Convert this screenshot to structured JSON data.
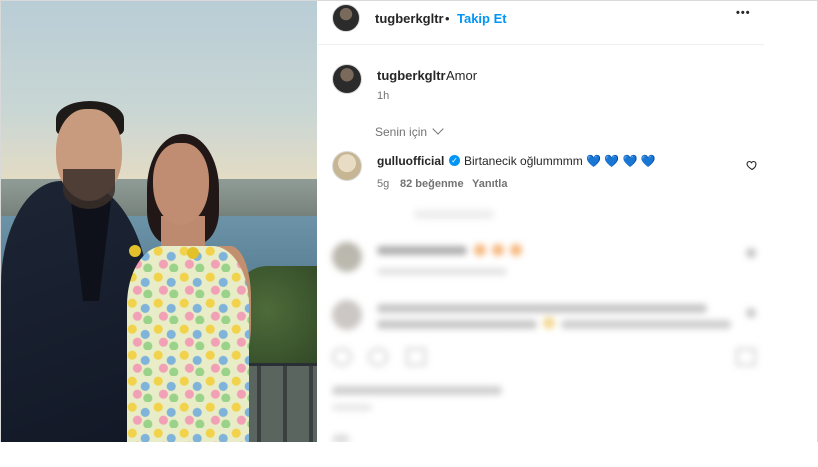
{
  "post": {
    "author": "tugberkgltr",
    "separator": "•",
    "follow_label": "Takip Et",
    "more_label": "•••"
  },
  "caption": {
    "author": "tugberkgltr",
    "text": "Amor",
    "time": "1h"
  },
  "comments_filter": {
    "label": "Senin için"
  },
  "top_comment": {
    "author": "gulluofficial",
    "verified_mark": "✓",
    "text": "Birtanecik oğlummmm 💙 💙 💙 💙",
    "time": "5g",
    "likes": "82 beğenme",
    "reply_label": "Yanıtla"
  },
  "colors": {
    "link": "#0095f6",
    "text": "#262626",
    "muted": "#737373"
  }
}
